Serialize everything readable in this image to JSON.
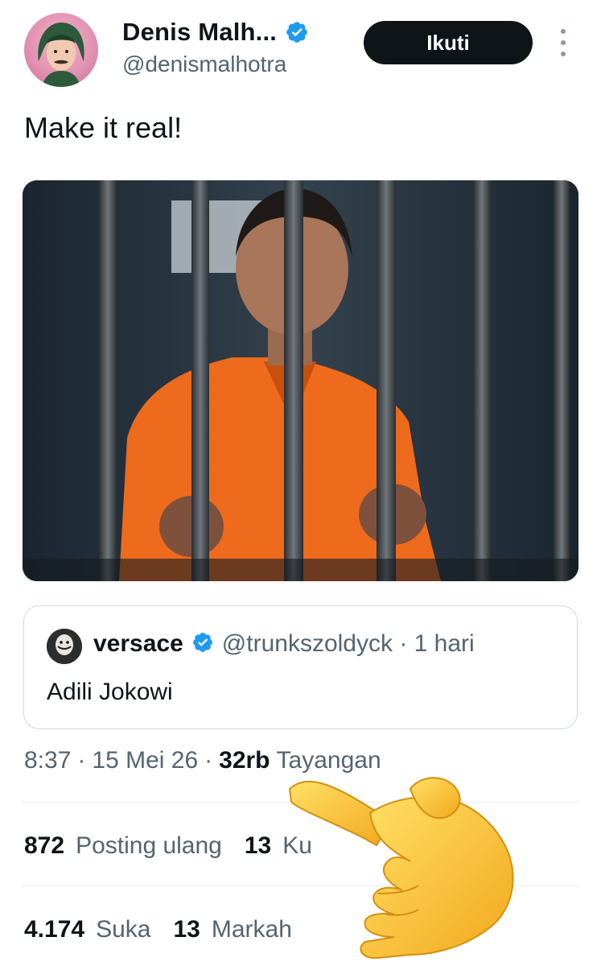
{
  "author": {
    "display_name": "Denis Malh...",
    "handle": "@denismalhotra",
    "follow_label": "Ikuti"
  },
  "tweet": {
    "text": "Make it real!"
  },
  "quote": {
    "name": "versace",
    "handle_time": "@trunkszoldyck · 1 hari",
    "text": "Adili Jokowi"
  },
  "meta": {
    "time": "8:37",
    "date": "15 Mei 26",
    "views_count": "32rb",
    "views_label": "Tayangan"
  },
  "stats": {
    "reposts_count": "872",
    "reposts_label": "Posting ulang",
    "quotes_count": "13",
    "quotes_label": "Ku",
    "likes_count": "4.174",
    "likes_label": "Suka",
    "bookmarks_count": "13",
    "bookmarks_label": "Markah"
  },
  "colors": {
    "verified": "#1d9bf0",
    "follow_bg": "#0f1419",
    "secondary_text": "#536471"
  }
}
